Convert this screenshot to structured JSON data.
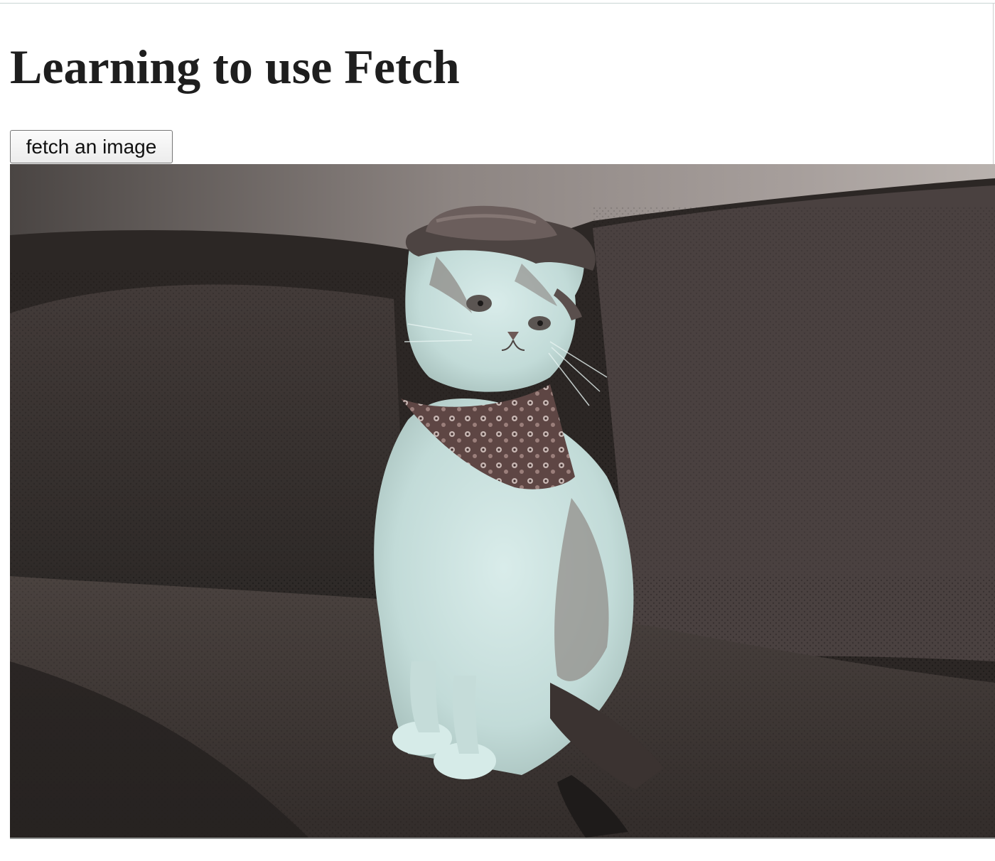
{
  "page": {
    "heading": "Learning to use Fetch",
    "button_label": "fetch an image"
  },
  "image": {
    "subject": "cat-photo"
  },
  "colors": {
    "text": "#1e1e1e",
    "button_border": "#767676",
    "couch": "#3d3633",
    "fur": "#c6dedb"
  }
}
